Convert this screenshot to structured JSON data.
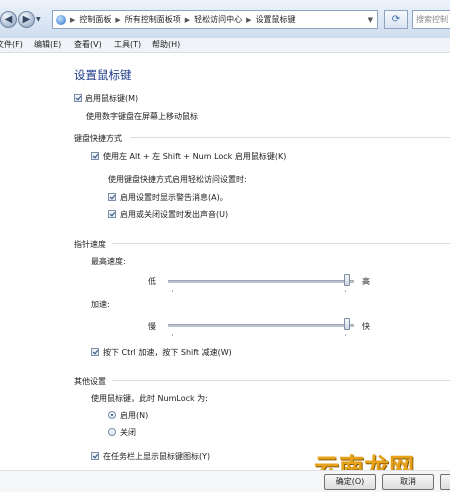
{
  "addressbar": {
    "breadcrumbs": [
      "控制面板",
      "所有控制面板项",
      "轻松访问中心",
      "设置鼠标键"
    ],
    "search_placeholder": "搜索控制"
  },
  "menubar": {
    "items": [
      "文件(F)",
      "编辑(E)",
      "查看(V)",
      "工具(T)",
      "帮助(H)"
    ]
  },
  "content": {
    "title": "设置鼠标键",
    "enable_mouse_keys": {
      "label": "启用鼠标键(M)",
      "checked": true
    },
    "enable_desc": "使用数字键盘在屏幕上移动鼠标",
    "shortcut_group": {
      "label": "键盘快捷方式",
      "use_shortcut": {
        "label": "使用左 Alt + 左 Shift + Num Lock 启用鼠标键(K)",
        "checked": true
      },
      "sub_desc": "使用键盘快捷方式启用轻松访问设置时:",
      "show_warning": {
        "label": "启用设置时显示警告消息(A)。",
        "checked": true
      },
      "play_sound": {
        "label": "启用或关闭设置时发出声音(U)",
        "checked": true
      }
    },
    "speed_group": {
      "label": "指针速度",
      "top_speed": {
        "label": "最高速度:",
        "low": "低",
        "high": "高",
        "value": 0.98
      },
      "acceleration": {
        "label": "加速:",
        "low": "慢",
        "high": "快",
        "value": 0.98
      },
      "ctrl_shift": {
        "label": "按下 Ctrl 加速，按下 Shift 减速(W)",
        "checked": true
      }
    },
    "other_group": {
      "label": "其他设置",
      "numlock_desc": "使用鼠标键，此时 NumLock 为:",
      "radio_on": {
        "label": "启用(N)",
        "selected": true
      },
      "radio_off": {
        "label": "关闭",
        "selected": false
      },
      "show_icon": {
        "label": "在任务栏上显示鼠标键图标(Y)",
        "checked": true
      }
    }
  },
  "buttons": {
    "ok": "确定(O)",
    "cancel": "取消"
  },
  "watermark": "云南龙网"
}
